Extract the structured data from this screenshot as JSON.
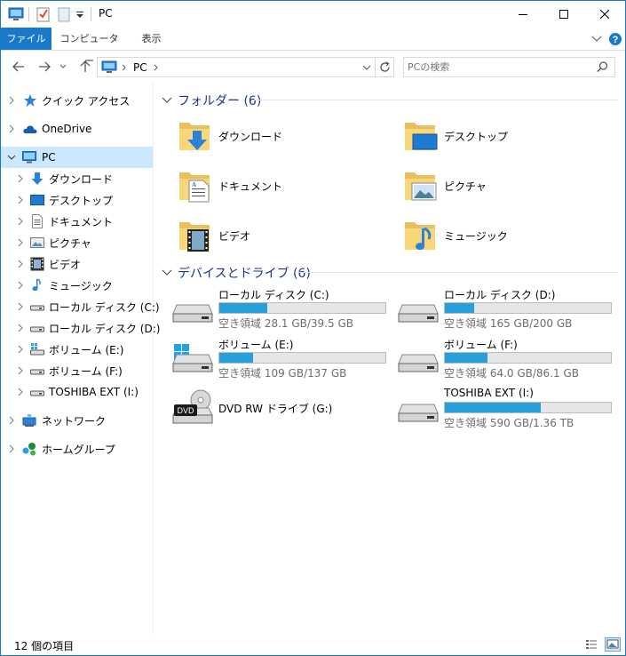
{
  "window": {
    "title": "PC"
  },
  "ribbon": {
    "tabs": [
      "ファイル",
      "コンピューター",
      "表示"
    ]
  },
  "address": {
    "path": [
      "PC"
    ]
  },
  "search": {
    "placeholder": "PCの検索"
  },
  "nav": {
    "items": [
      {
        "label": "クイック アクセス",
        "icon": "star-icon"
      },
      {
        "label": "OneDrive",
        "icon": "cloud-icon"
      },
      {
        "label": "PC",
        "icon": "computer-icon",
        "selected": true
      },
      {
        "label": "ダウンロード",
        "icon": "download-folder-icon"
      },
      {
        "label": "デスクトップ",
        "icon": "desktop-folder-icon"
      },
      {
        "label": "ドキュメント",
        "icon": "documents-folder-icon"
      },
      {
        "label": "ピクチャ",
        "icon": "pictures-folder-icon"
      },
      {
        "label": "ビデオ",
        "icon": "videos-folder-icon"
      },
      {
        "label": "ミュージック",
        "icon": "music-folder-icon"
      },
      {
        "label": "ローカル ディスク (C:)",
        "icon": "drive-icon"
      },
      {
        "label": "ローカル ディスク (D:)",
        "icon": "drive-icon"
      },
      {
        "label": "ボリューム (E:)",
        "icon": "drive-icon"
      },
      {
        "label": "ボリューム (F:)",
        "icon": "drive-icon"
      },
      {
        "label": "TOSHIBA EXT (I:)",
        "icon": "drive-icon"
      },
      {
        "label": "ネットワーク",
        "icon": "network-icon"
      },
      {
        "label": "ホームグループ",
        "icon": "homegroup-icon"
      }
    ]
  },
  "groups": {
    "folders": {
      "title": "フォルダー (6)"
    },
    "drives": {
      "title": "デバイスとドライブ (6)"
    }
  },
  "folders": [
    {
      "label": "ダウンロード",
      "icon": "download-folder-icon"
    },
    {
      "label": "デスクトップ",
      "icon": "desktop-folder-icon"
    },
    {
      "label": "ドキュメント",
      "icon": "documents-folder-icon"
    },
    {
      "label": "ピクチャ",
      "icon": "pictures-folder-icon"
    },
    {
      "label": "ビデオ",
      "icon": "videos-folder-icon"
    },
    {
      "label": "ミュージック",
      "icon": "music-folder-icon"
    }
  ],
  "drives": [
    {
      "label": "ローカル ディスク (C:)",
      "free": "空き領域 28.1 GB/39.5 GB",
      "used_fraction": 0.29
    },
    {
      "label": "ローカル ディスク (D:)",
      "free": "空き領域 165 GB/200 GB",
      "used_fraction": 0.175
    },
    {
      "label": "ボリューム (E:)",
      "free": "空き領域 109 GB/137 GB",
      "used_fraction": 0.204
    },
    {
      "label": "ボリューム (F:)",
      "free": "空き領域 64.0 GB/86.1 GB",
      "used_fraction": 0.257
    },
    {
      "label": "DVD RW ドライブ (G:)"
    },
    {
      "label": "TOSHIBA EXT (I:)",
      "free": "空き領域 590 GB/1.36 TB",
      "used_fraction": 0.576
    }
  ],
  "dvd_icon_text": "DVD",
  "status": {
    "count": "12 個の項目"
  },
  "colors": {
    "accent": "#1979ca",
    "bar_fill": "#26a0da",
    "group_header": "#1e3287",
    "selection": "#cce8ff"
  }
}
